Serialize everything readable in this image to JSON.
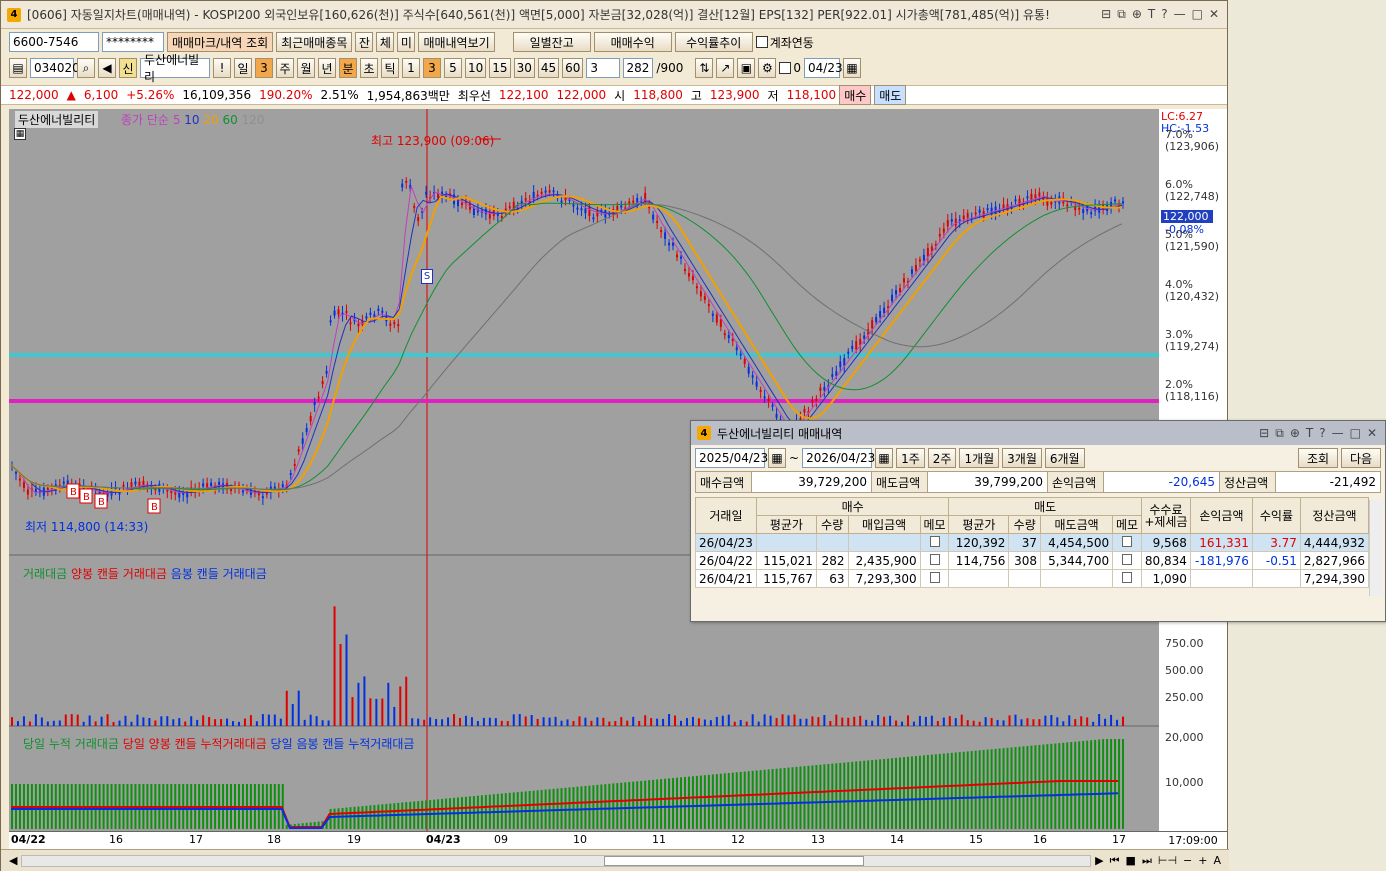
{
  "window": {
    "icon": "4",
    "title": "[0606] 자동일지차트(매매내역) - KOSPI200 외국인보유[160,626(천)] 주식수[640,561(천)] 액면[5,000] 자본금[32,028(억)] 결산[12월] EPS[132] PER[922.01] 시가총액[781,485(억)] 유통!",
    "controls": [
      "⊟",
      "⧉",
      "⊕",
      "T",
      "?",
      "—",
      "□",
      "✕"
    ]
  },
  "toolbar1": {
    "account": "6600-7546",
    "password": "********",
    "btn_mark": "매매마크/내역 조회",
    "btn_recent": "최근매매종목",
    "btn_jan": "잔",
    "btn_che": "체",
    "btn_mi": "미",
    "btn_history": "매매내역보기",
    "btn_daily": "일별잔고",
    "btn_profit": "매매수익",
    "btn_trend": "수익률추이",
    "chk_link": "계좌연동"
  },
  "toolbar2": {
    "code": "034020",
    "stock_badge": "신",
    "stock_name": "두산에너빌리",
    "period_il": "일",
    "period_val": "3",
    "period_ju": "주",
    "period_wol": "월",
    "period_nyeon": "년",
    "period_bun": "분",
    "period_cho": "초",
    "period_tik": "틱",
    "intervals": [
      "1",
      "3",
      "5",
      "10",
      "15",
      "30",
      "45",
      "60"
    ],
    "interval_input": "3",
    "count": "282",
    "count_max": "/900",
    "chk_zero": "0",
    "date": "04/23"
  },
  "priceinfo": {
    "price": "122,000",
    "arrow": "▲",
    "change": "6,100",
    "pct": "+5.26%",
    "volume": "16,109,356",
    "vol_ratio": "190.20%",
    "turnover": "2.51%",
    "amount": "1,954,863백만",
    "prior_label": "최우선",
    "ask": "122,100",
    "bid": "122,000",
    "open_label": "시",
    "open": "118,800",
    "high_label": "고",
    "high": "123,900",
    "low_label": "저",
    "low": "118,100",
    "buy": "매수",
    "sell": "매도"
  },
  "chart": {
    "stock_label": "두산에너빌리티",
    "ma_label": "종가 단순",
    "ma_periods": [
      "5",
      "10",
      "20",
      "60",
      "120"
    ],
    "high_mark": "최고 123,900 (09:06)",
    "low_mark": "최저 114,800 (14:33)",
    "lc": "LC:6.27",
    "hc": "HC:-1.53",
    "price_axis": [
      {
        "pct": "7.0%",
        "price": "(123,906)"
      },
      {
        "pct": "6.0%",
        "price": "(122,748)"
      },
      {
        "pct": "5.0%",
        "price": "(121,590)"
      },
      {
        "pct": "4.0%",
        "price": "(120,432)"
      },
      {
        "pct": "3.0%",
        "price": "(119,274)"
      },
      {
        "pct": "2.0%",
        "price": "(118,116)"
      }
    ],
    "current_price": "122,000",
    "current_pct": "-0.08%",
    "vol_legend_a": "거래대금",
    "vol_legend_b": "양봉 캔들 거래대금",
    "vol_legend_c": "음봉 캔들 거래대금",
    "vol_axis": [
      "750.00",
      "500.00",
      "250.00"
    ],
    "cum_legend_a": "당일 누적 거래대금",
    "cum_legend_b": "당일 양봉 캔들 누적거래대금",
    "cum_legend_c": "당일 음봉 캔들 누적거래대금",
    "cum_axis": [
      "20,000",
      "10,000"
    ],
    "x_labels": [
      "04/22",
      "16",
      "17",
      "18",
      "19",
      "04/23",
      "09",
      "10",
      "11",
      "12",
      "13",
      "14",
      "15",
      "16",
      "17"
    ],
    "time": "17:09:00",
    "s_marker": "S",
    "b_marker": "B"
  },
  "popup": {
    "icon": "4",
    "title": "두산에너빌리티 매매내역",
    "controls": [
      "⊟",
      "⧉",
      "⊕",
      "T",
      "?",
      "—",
      "□",
      "✕"
    ],
    "date_from": "2025/04/23",
    "tilde": "~",
    "date_to": "2026/04/23",
    "ranges": [
      "1주",
      "2주",
      "1개월",
      "3개월",
      "6개월"
    ],
    "btn_query": "조회",
    "btn_next": "다음",
    "buy_amt_label": "매수금액",
    "buy_amt": "39,729,200",
    "sell_amt_label": "매도금액",
    "sell_amt": "39,799,200",
    "pl_label": "손익금액",
    "pl": "-20,645",
    "settle_label": "정산금액",
    "settle": "-21,492",
    "headers": {
      "date": "거래일",
      "buy": "매수",
      "sell": "매도",
      "fee": "수수료\n+제세금",
      "fee1": "수수료",
      "fee2": "+제세금",
      "pl": "손익금액",
      "rate": "수익률",
      "settle": "정산금액",
      "avg": "평균가",
      "qty": "수량",
      "buy_amt": "매입금액",
      "memo": "메모",
      "sell_amt": "매도금액"
    },
    "rows": [
      {
        "date": "26/04/23",
        "b_avg": "",
        "b_qty": "",
        "b_amt": "",
        "s_avg": "120,392",
        "s_qty": "37",
        "s_amt": "4,454,500",
        "fee": "9,568",
        "pl": "161,331",
        "rate": "3.77",
        "settle": "4,444,932"
      },
      {
        "date": "26/04/22",
        "b_avg": "115,021",
        "b_qty": "282",
        "b_amt": "2,435,900",
        "s_avg": "114,756",
        "s_qty": "308",
        "s_amt": "5,344,700",
        "fee": "80,834",
        "pl": "-181,976",
        "rate": "-0.51",
        "settle": "2,827,966"
      },
      {
        "date": "26/04/21",
        "b_avg": "115,767",
        "b_qty": "63",
        "b_amt": "7,293,300",
        "s_avg": "",
        "s_qty": "",
        "s_amt": "",
        "fee": "1,090",
        "pl": "",
        "rate": "",
        "settle": "7,294,390"
      }
    ]
  },
  "colors": {
    "up": "#e00000",
    "down": "#0030e0",
    "ma5": "#c040c0",
    "ma10": "#2030c0",
    "ma20": "#f0a000",
    "ma60": "#109030",
    "ma120": "#707070",
    "hline_cyan": "#40c8d0",
    "hline_magenta": "#e020c0",
    "cum_fill": "#109010"
  }
}
